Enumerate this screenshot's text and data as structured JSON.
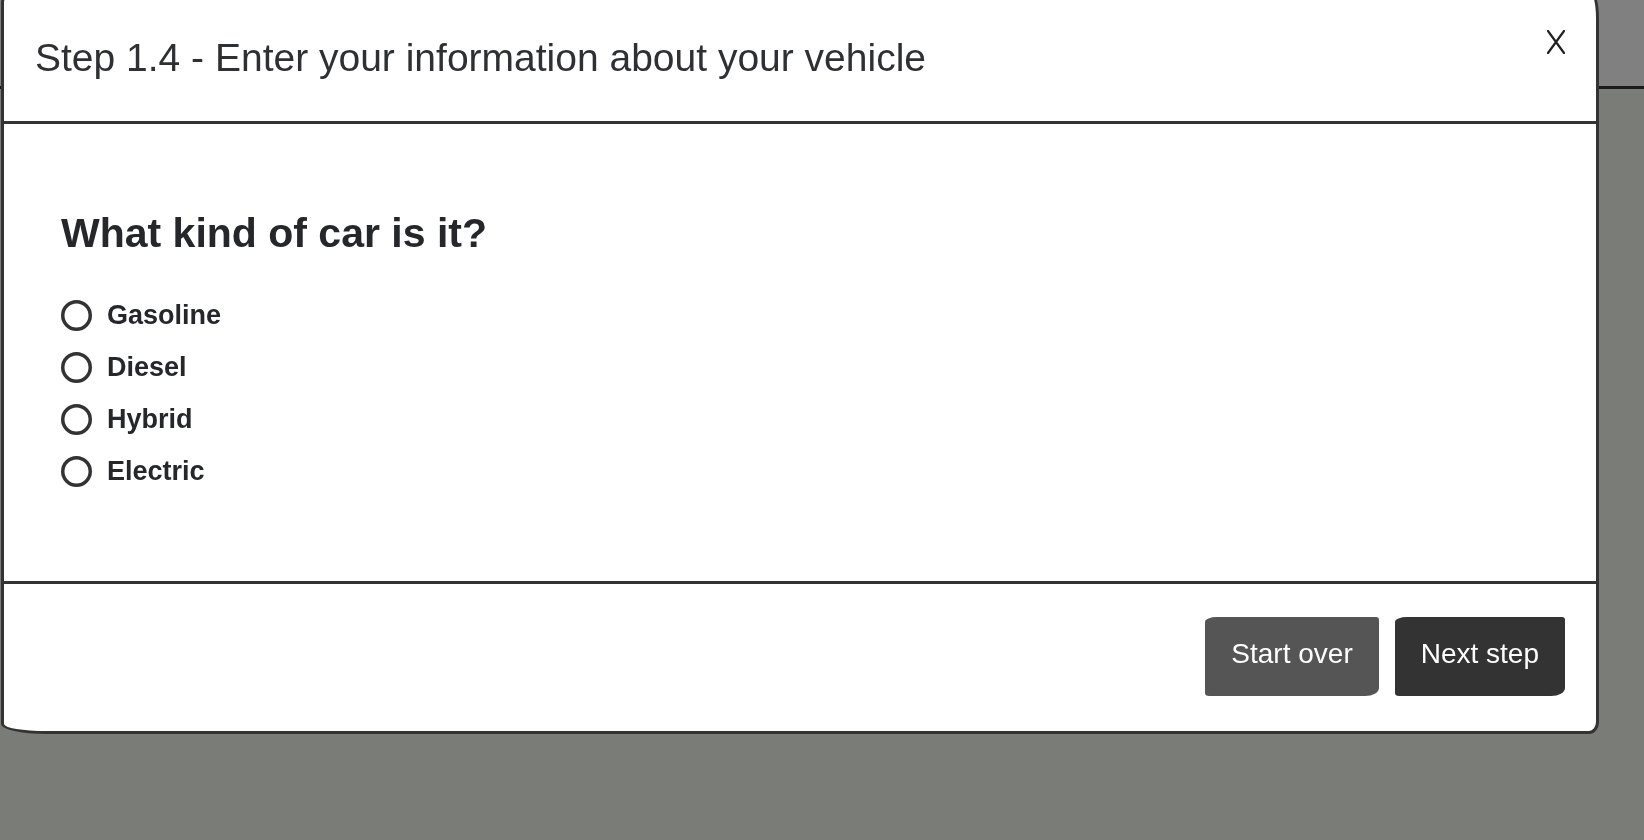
{
  "dialog": {
    "title": "Step 1.4 - Enter your information about your vehicle"
  },
  "question": {
    "title": "What kind of car is it?",
    "options": [
      {
        "label": "Gasoline",
        "selected": false
      },
      {
        "label": "Diesel",
        "selected": false
      },
      {
        "label": "Hybrid",
        "selected": false
      },
      {
        "label": "Electric",
        "selected": false
      }
    ]
  },
  "buttons": [
    {
      "label": "Start over",
      "kind": "secondary"
    },
    {
      "label": "Next step",
      "kind": "primary"
    }
  ]
}
